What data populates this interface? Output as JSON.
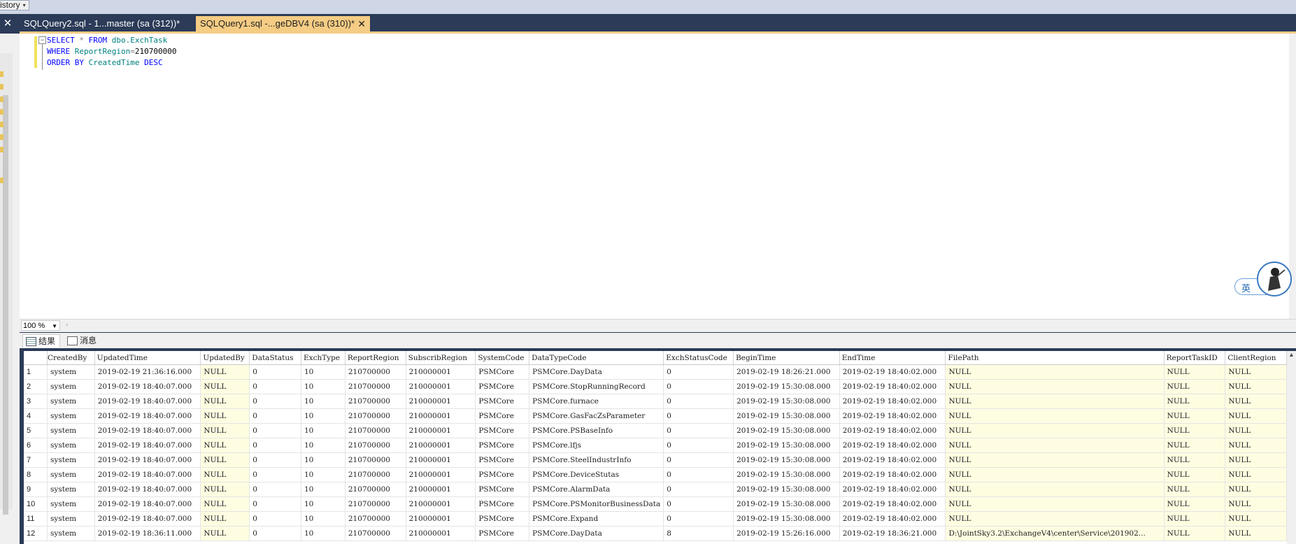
{
  "window": {
    "history_label": "istory",
    "tabs": [
      {
        "label": "SQLQuery2.sql - 1...master (sa (312))*",
        "active": false
      },
      {
        "label": "SQLQuery1.sql -...geDBV4 (sa (310))*",
        "active": true
      }
    ],
    "close_glyph": "✕",
    "tab_close_glyph": "✕"
  },
  "editor": {
    "line1": {
      "kw1": "SELECT",
      "star": "*",
      "kw2": "FROM",
      "obj": "dbo.ExchTask"
    },
    "line2": {
      "kw": "WHERE",
      "col": "ReportRegion",
      "op": "=",
      "val": "210700000"
    },
    "line3": {
      "kw": "ORDER BY",
      "col": "CreatedTime",
      "dir": "DESC"
    }
  },
  "zoom": {
    "value": "100 %"
  },
  "results_tabs": [
    {
      "label": "结果",
      "icon": "grid-icon"
    },
    {
      "label": "消息",
      "icon": "message-icon"
    }
  ],
  "ime": {
    "label": "英"
  },
  "grid": {
    "columns": [
      "",
      "CreatedBy",
      "UpdatedTime",
      "UpdatedBy",
      "DataStatus",
      "ExchType",
      "ReportRegion",
      "SubscribRegion",
      "SystemCode",
      "DataTypeCode",
      "ExchStatusCode",
      "BeginTime",
      "EndTime",
      "FilePath",
      "ReportTaskID",
      "ClientRegion"
    ],
    "rows": [
      [
        "1",
        "system",
        "2019-02-19 21:36:16.000",
        "NULL",
        "0",
        "10",
        "210700000",
        "210000001",
        "PSMCore",
        "PSMCore.DayData",
        "0",
        "2019-02-19 18:26:21.000",
        "2019-02-19 18:40:02.000",
        "NULL",
        "NULL",
        "NULL"
      ],
      [
        "2",
        "system",
        "2019-02-19 18:40:07.000",
        "NULL",
        "0",
        "10",
        "210700000",
        "210000001",
        "PSMCore",
        "PSMCore.StopRunningRecord",
        "0",
        "2019-02-19 15:30:08.000",
        "2019-02-19 18:40:02.000",
        "NULL",
        "NULL",
        "NULL"
      ],
      [
        "3",
        "system",
        "2019-02-19 18:40:07.000",
        "NULL",
        "0",
        "10",
        "210700000",
        "210000001",
        "PSMCore",
        "PSMCore.furnace",
        "0",
        "2019-02-19 15:30:08.000",
        "2019-02-19 18:40:02.000",
        "NULL",
        "NULL",
        "NULL"
      ],
      [
        "4",
        "system",
        "2019-02-19 18:40:07.000",
        "NULL",
        "0",
        "10",
        "210700000",
        "210000001",
        "PSMCore",
        "PSMCore.GasFacZsParameter",
        "0",
        "2019-02-19 15:30:08.000",
        "2019-02-19 18:40:02.000",
        "NULL",
        "NULL",
        "NULL"
      ],
      [
        "5",
        "system",
        "2019-02-19 18:40:07.000",
        "NULL",
        "0",
        "10",
        "210700000",
        "210000001",
        "PSMCore",
        "PSMCore.PSBaseInfo",
        "0",
        "2019-02-19 15:30:08.000",
        "2019-02-19 18:40:02.000",
        "NULL",
        "NULL",
        "NULL"
      ],
      [
        "6",
        "system",
        "2019-02-19 18:40:07.000",
        "NULL",
        "0",
        "10",
        "210700000",
        "210000001",
        "PSMCore",
        "PSMCore.lfjs",
        "0",
        "2019-02-19 15:30:08.000",
        "2019-02-19 18:40:02.000",
        "NULL",
        "NULL",
        "NULL"
      ],
      [
        "7",
        "system",
        "2019-02-19 18:40:07.000",
        "NULL",
        "0",
        "10",
        "210700000",
        "210000001",
        "PSMCore",
        "PSMCore.SteelIndustrInfo",
        "0",
        "2019-02-19 15:30:08.000",
        "2019-02-19 18:40:02.000",
        "NULL",
        "NULL",
        "NULL"
      ],
      [
        "8",
        "system",
        "2019-02-19 18:40:07.000",
        "NULL",
        "0",
        "10",
        "210700000",
        "210000001",
        "PSMCore",
        "PSMCore.DeviceStutas",
        "0",
        "2019-02-19 15:30:08.000",
        "2019-02-19 18:40:02.000",
        "NULL",
        "NULL",
        "NULL"
      ],
      [
        "9",
        "system",
        "2019-02-19 18:40:07.000",
        "NULL",
        "0",
        "10",
        "210700000",
        "210000001",
        "PSMCore",
        "PSMCore.AlarmData",
        "0",
        "2019-02-19 15:30:08.000",
        "2019-02-19 18:40:02.000",
        "NULL",
        "NULL",
        "NULL"
      ],
      [
        "10",
        "system",
        "2019-02-19 18:40:07.000",
        "NULL",
        "0",
        "10",
        "210700000",
        "210000001",
        "PSMCore",
        "PSMCore.PSMonitorBusinessData",
        "0",
        "2019-02-19 15:30:08.000",
        "2019-02-19 18:40:02.000",
        "NULL",
        "NULL",
        "NULL"
      ],
      [
        "11",
        "system",
        "2019-02-19 18:40:07.000",
        "NULL",
        "0",
        "10",
        "210700000",
        "210000001",
        "PSMCore",
        "PSMCore.Expand",
        "0",
        "2019-02-19 15:30:08.000",
        "2019-02-19 18:40:02.000",
        "NULL",
        "NULL",
        "NULL"
      ],
      [
        "12",
        "system",
        "2019-02-19 18:36:11.000",
        "NULL",
        "0",
        "10",
        "210700000",
        "210000001",
        "PSMCore",
        "PSMCore.DayData",
        "8",
        "2019-02-19 15:26:16.000",
        "2019-02-19 18:36:21.000",
        "D:\\JointSky3.2\\ExchangeV4\\center\\Service\\201902...",
        "NULL",
        "NULL"
      ]
    ]
  }
}
